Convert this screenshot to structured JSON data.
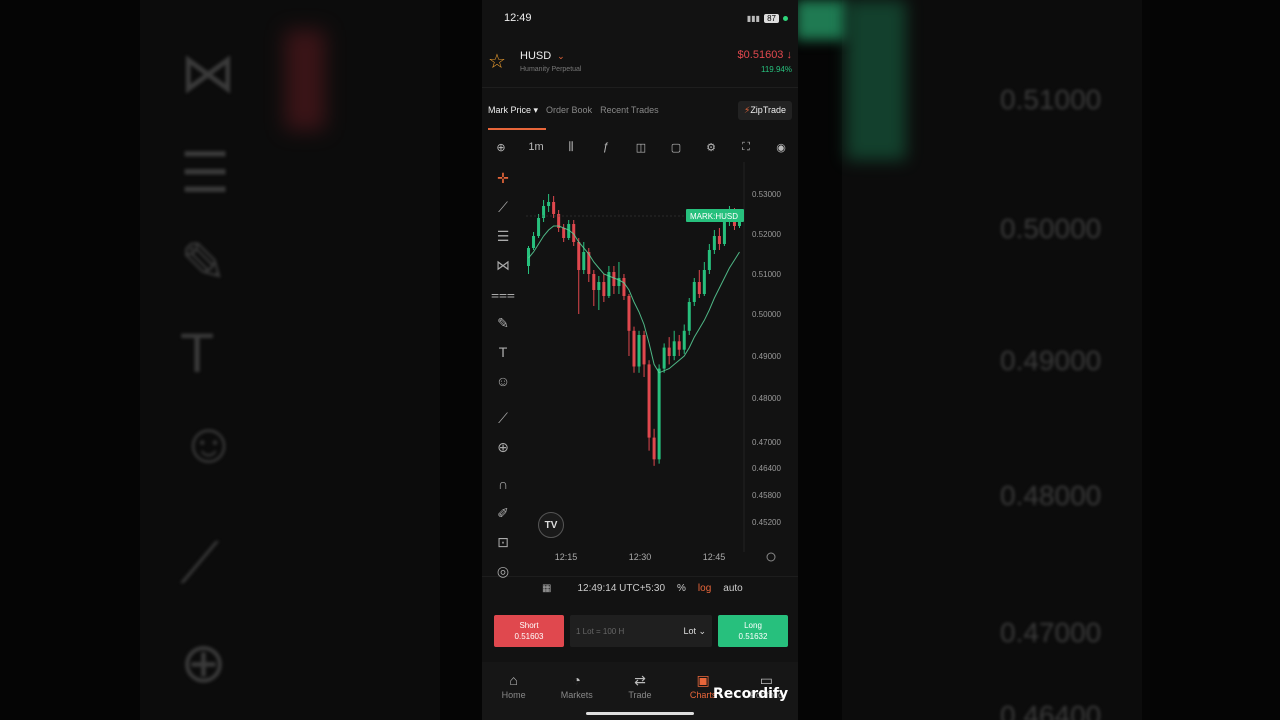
{
  "status": {
    "time": "12:49",
    "battery": "87"
  },
  "header": {
    "symbol": "HUSD",
    "subtitle": "Humanity Perpetual",
    "price": "$0.51603",
    "price_arrow": "↓",
    "change": "119.94%"
  },
  "tabs": [
    {
      "label": "Mark Price"
    },
    {
      "label": "Order Book"
    },
    {
      "label": "Recent Trades"
    }
  ],
  "zip_button": "ZipTrade",
  "toolbar": {
    "interval": "1m"
  },
  "chart_data": {
    "type": "candlestick",
    "price_tag": "MARK:HUSD",
    "y_ticks": [
      "0.53000",
      "0.52000",
      "0.51000",
      "0.50000",
      "0.49000",
      "0.48000",
      "0.47000",
      "0.46400",
      "0.45800",
      "0.45200"
    ],
    "x_ticks": [
      "12:15",
      "12:30",
      "12:45"
    ],
    "candles": [
      [
        0.512,
        0.5165,
        0.51,
        0.517
      ],
      [
        0.5165,
        0.5195,
        0.516,
        0.5205
      ],
      [
        0.5195,
        0.524,
        0.519,
        0.525
      ],
      [
        0.524,
        0.527,
        0.523,
        0.5285
      ],
      [
        0.527,
        0.528,
        0.5255,
        0.53
      ],
      [
        0.528,
        0.525,
        0.524,
        0.5295
      ],
      [
        0.525,
        0.5215,
        0.5205,
        0.526
      ],
      [
        0.5215,
        0.519,
        0.518,
        0.5225
      ],
      [
        0.519,
        0.5225,
        0.5185,
        0.5235
      ],
      [
        0.5225,
        0.518,
        0.517,
        0.5235
      ],
      [
        0.518,
        0.511,
        0.5,
        0.519
      ],
      [
        0.511,
        0.5155,
        0.51,
        0.518
      ],
      [
        0.5155,
        0.51,
        0.508,
        0.5165
      ],
      [
        0.51,
        0.506,
        0.502,
        0.511
      ],
      [
        0.506,
        0.508,
        0.501,
        0.5095
      ],
      [
        0.508,
        0.5045,
        0.503,
        0.51
      ],
      [
        0.5045,
        0.5105,
        0.504,
        0.512
      ],
      [
        0.5105,
        0.507,
        0.505,
        0.512
      ],
      [
        0.507,
        0.509,
        0.505,
        0.513
      ],
      [
        0.509,
        0.5045,
        0.5035,
        0.51
      ],
      [
        0.5045,
        0.496,
        0.49,
        0.505
      ],
      [
        0.496,
        0.4875,
        0.486,
        0.497
      ],
      [
        0.4875,
        0.495,
        0.486,
        0.496
      ],
      [
        0.495,
        0.488,
        0.485,
        0.496
      ],
      [
        0.488,
        0.471,
        0.468,
        0.489
      ],
      [
        0.471,
        0.466,
        0.4645,
        0.473
      ],
      [
        0.466,
        0.487,
        0.465,
        0.488
      ],
      [
        0.487,
        0.492,
        0.486,
        0.493
      ],
      [
        0.492,
        0.49,
        0.488,
        0.4945
      ],
      [
        0.49,
        0.4935,
        0.489,
        0.496
      ],
      [
        0.4935,
        0.4915,
        0.49,
        0.495
      ],
      [
        0.4915,
        0.496,
        0.4905,
        0.4975
      ],
      [
        0.496,
        0.503,
        0.495,
        0.504
      ],
      [
        0.503,
        0.508,
        0.502,
        0.509
      ],
      [
        0.508,
        0.505,
        0.504,
        0.511
      ],
      [
        0.505,
        0.511,
        0.5045,
        0.513
      ],
      [
        0.511,
        0.516,
        0.51,
        0.5175
      ],
      [
        0.516,
        0.5195,
        0.515,
        0.521
      ],
      [
        0.5195,
        0.5175,
        0.516,
        0.5215
      ],
      [
        0.5175,
        0.523,
        0.517,
        0.5245
      ],
      [
        0.523,
        0.525,
        0.522,
        0.527
      ],
      [
        0.525,
        0.522,
        0.521,
        0.5265
      ],
      [
        0.522,
        0.5245,
        0.5215,
        0.526
      ]
    ],
    "ma": [
      0.514,
      0.5155,
      0.5175,
      0.5195,
      0.521,
      0.522,
      0.522,
      0.5215,
      0.521,
      0.52,
      0.518,
      0.5165,
      0.515,
      0.513,
      0.5115,
      0.51,
      0.5095,
      0.509,
      0.5085,
      0.5078,
      0.506,
      0.503,
      0.5005,
      0.4975,
      0.493,
      0.488,
      0.486,
      0.4865,
      0.487,
      0.488,
      0.489,
      0.49,
      0.492,
      0.4945,
      0.4965,
      0.4985,
      0.501,
      0.504,
      0.5065,
      0.509,
      0.5115,
      0.5135,
      0.5155
    ]
  },
  "timebar": {
    "timestamp": "12:49:14 UTC+5:30",
    "percent": "%",
    "log": "log",
    "auto": "auto"
  },
  "trade": {
    "short_label": "Short",
    "short_price": "0.51603",
    "lot_placeholder": "1 Lot = 100 H",
    "lot_select": "Lot",
    "long_label": "Long",
    "long_price": "0.51632"
  },
  "nav": [
    {
      "label": "Home"
    },
    {
      "label": "Markets"
    },
    {
      "label": "Trade"
    },
    {
      "label": "Charts"
    },
    {
      "label": "Portfolio"
    }
  ],
  "watermark": "Recordify",
  "background": {
    "prices": [
      "0.51000",
      "0.50000",
      "0.49000",
      "0.48000",
      "0.47000",
      "0.46400"
    ]
  },
  "colors": {
    "up": "#27c07d",
    "down": "#e0484e",
    "accent": "#e8663a"
  }
}
